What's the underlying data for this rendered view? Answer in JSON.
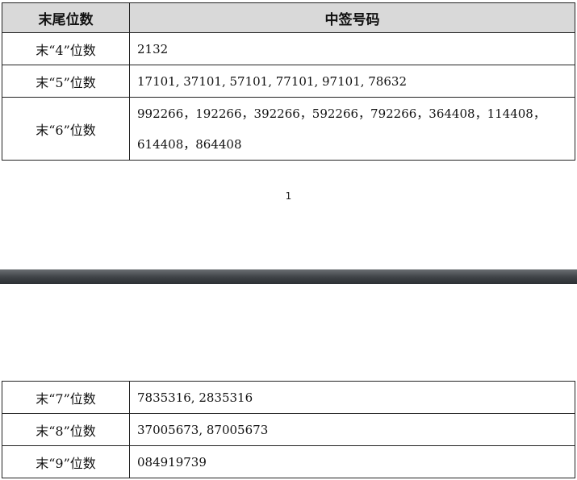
{
  "table": {
    "header": {
      "col1": "末尾位数",
      "col2": "中签号码"
    },
    "rows_page1": [
      {
        "digits": "末“4”位数",
        "numbers": "2132"
      },
      {
        "digits": "末“5”位数",
        "numbers": "17101, 37101, 57101, 77101, 97101, 78632"
      },
      {
        "digits": "末“6”位数",
        "numbers": "992266，192266，392266，592266，792266，364408，114408，614408，864408"
      }
    ],
    "rows_page2": [
      {
        "digits": "末“7”位数",
        "numbers": "7835316, 2835316"
      },
      {
        "digits": "末“8”位数",
        "numbers": "37005673, 87005673"
      },
      {
        "digits": "末“9”位数",
        "numbers": "084919739"
      }
    ]
  },
  "page_number": "1"
}
